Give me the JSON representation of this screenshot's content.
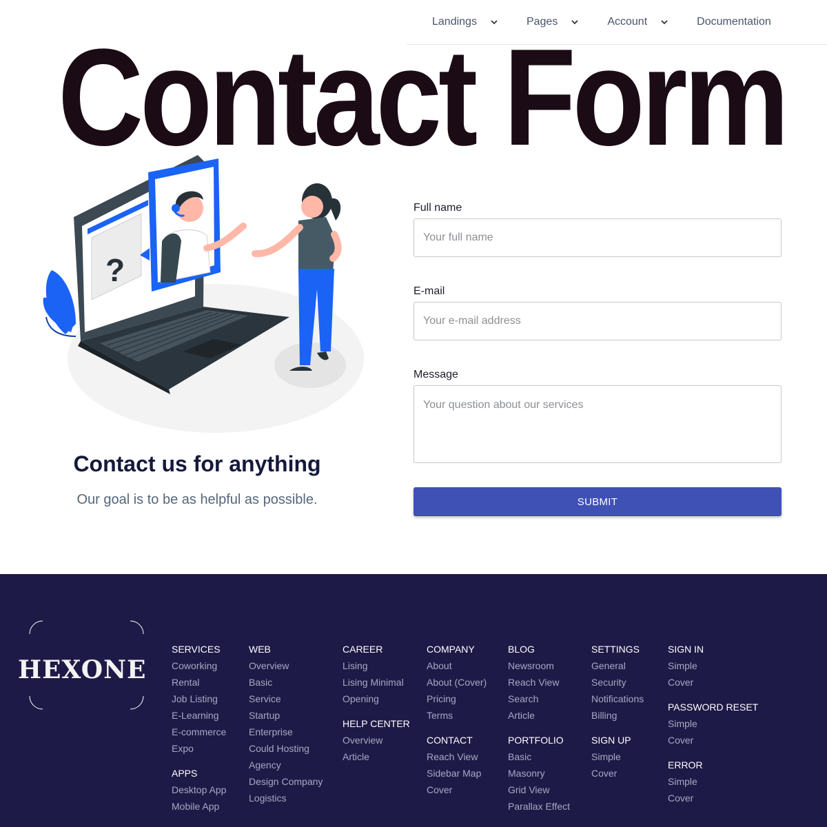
{
  "nav": {
    "items": [
      {
        "label": "Landings",
        "dropdown": true
      },
      {
        "label": "Pages",
        "dropdown": true
      },
      {
        "label": "Account",
        "dropdown": true
      },
      {
        "label": "Documentation",
        "dropdown": false
      }
    ]
  },
  "hero": {
    "title": "Contact Form"
  },
  "contact": {
    "heading": "Contact us for anything",
    "subtext": "Our goal is to be as helpful as possible."
  },
  "form": {
    "fullname_label": "Full name",
    "fullname_placeholder": "Your full name",
    "email_label": "E-mail",
    "email_placeholder": "Your e-mail address",
    "message_label": "Message",
    "message_placeholder": "Your question about our services",
    "submit_label": "SUBMIT"
  },
  "footer": {
    "logo": "HEXONE",
    "columns": [
      {
        "groups": [
          {
            "title": "SERVICES",
            "links": [
              "Coworking",
              "Rental",
              "Job Listing",
              "E-Learning",
              "E-commerce",
              "Expo"
            ]
          },
          {
            "title": "APPS",
            "links": [
              "Desktop App",
              "Mobile App"
            ]
          }
        ]
      },
      {
        "groups": [
          {
            "title": "WEB",
            "links": [
              "Overview",
              "Basic",
              "Service",
              "Startup",
              "Enterprise",
              "Could Hosting",
              "Agency",
              "Design Company",
              "Logistics"
            ]
          }
        ]
      },
      {
        "groups": [
          {
            "title": "CAREER",
            "links": [
              "Lising",
              "Lising Minimal",
              "Opening"
            ]
          },
          {
            "title": "HELP CENTER",
            "links": [
              "Overview",
              "Article"
            ]
          }
        ]
      },
      {
        "groups": [
          {
            "title": "COMPANY",
            "links": [
              "About",
              "About (Cover)",
              "Pricing",
              "Terms"
            ]
          },
          {
            "title": "CONTACT",
            "links": [
              "Reach View",
              "Sidebar Map",
              "Cover"
            ]
          }
        ]
      },
      {
        "groups": [
          {
            "title": "BLOG",
            "links": [
              "Newsroom",
              "Reach View",
              "Search",
              "Article"
            ]
          },
          {
            "title": "PORTFOLIO",
            "links": [
              "Basic",
              "Masonry",
              "Grid View",
              "Parallax Effect"
            ]
          }
        ]
      },
      {
        "groups": [
          {
            "title": "SETTINGS",
            "links": [
              "General",
              "Security",
              "Notifications",
              "Billing"
            ]
          },
          {
            "title": "SIGN UP",
            "links": [
              "Simple",
              "Cover"
            ]
          }
        ]
      },
      {
        "groups": [
          {
            "title": "SIGN IN",
            "links": [
              "Simple",
              "Cover"
            ]
          },
          {
            "title": "PASSWORD RESET",
            "links": [
              "Simple",
              "Cover"
            ]
          },
          {
            "title": "ERROR",
            "links": [
              "Simple",
              "Cover"
            ]
          }
        ]
      }
    ]
  },
  "colors": {
    "accent": "#3f51b5",
    "footer_bg": "#1e1a47",
    "illustration_blue": "#1a63f4",
    "title": "#1b0b15"
  },
  "icons": {
    "nav_dropdown": "chevron-down-icon"
  }
}
